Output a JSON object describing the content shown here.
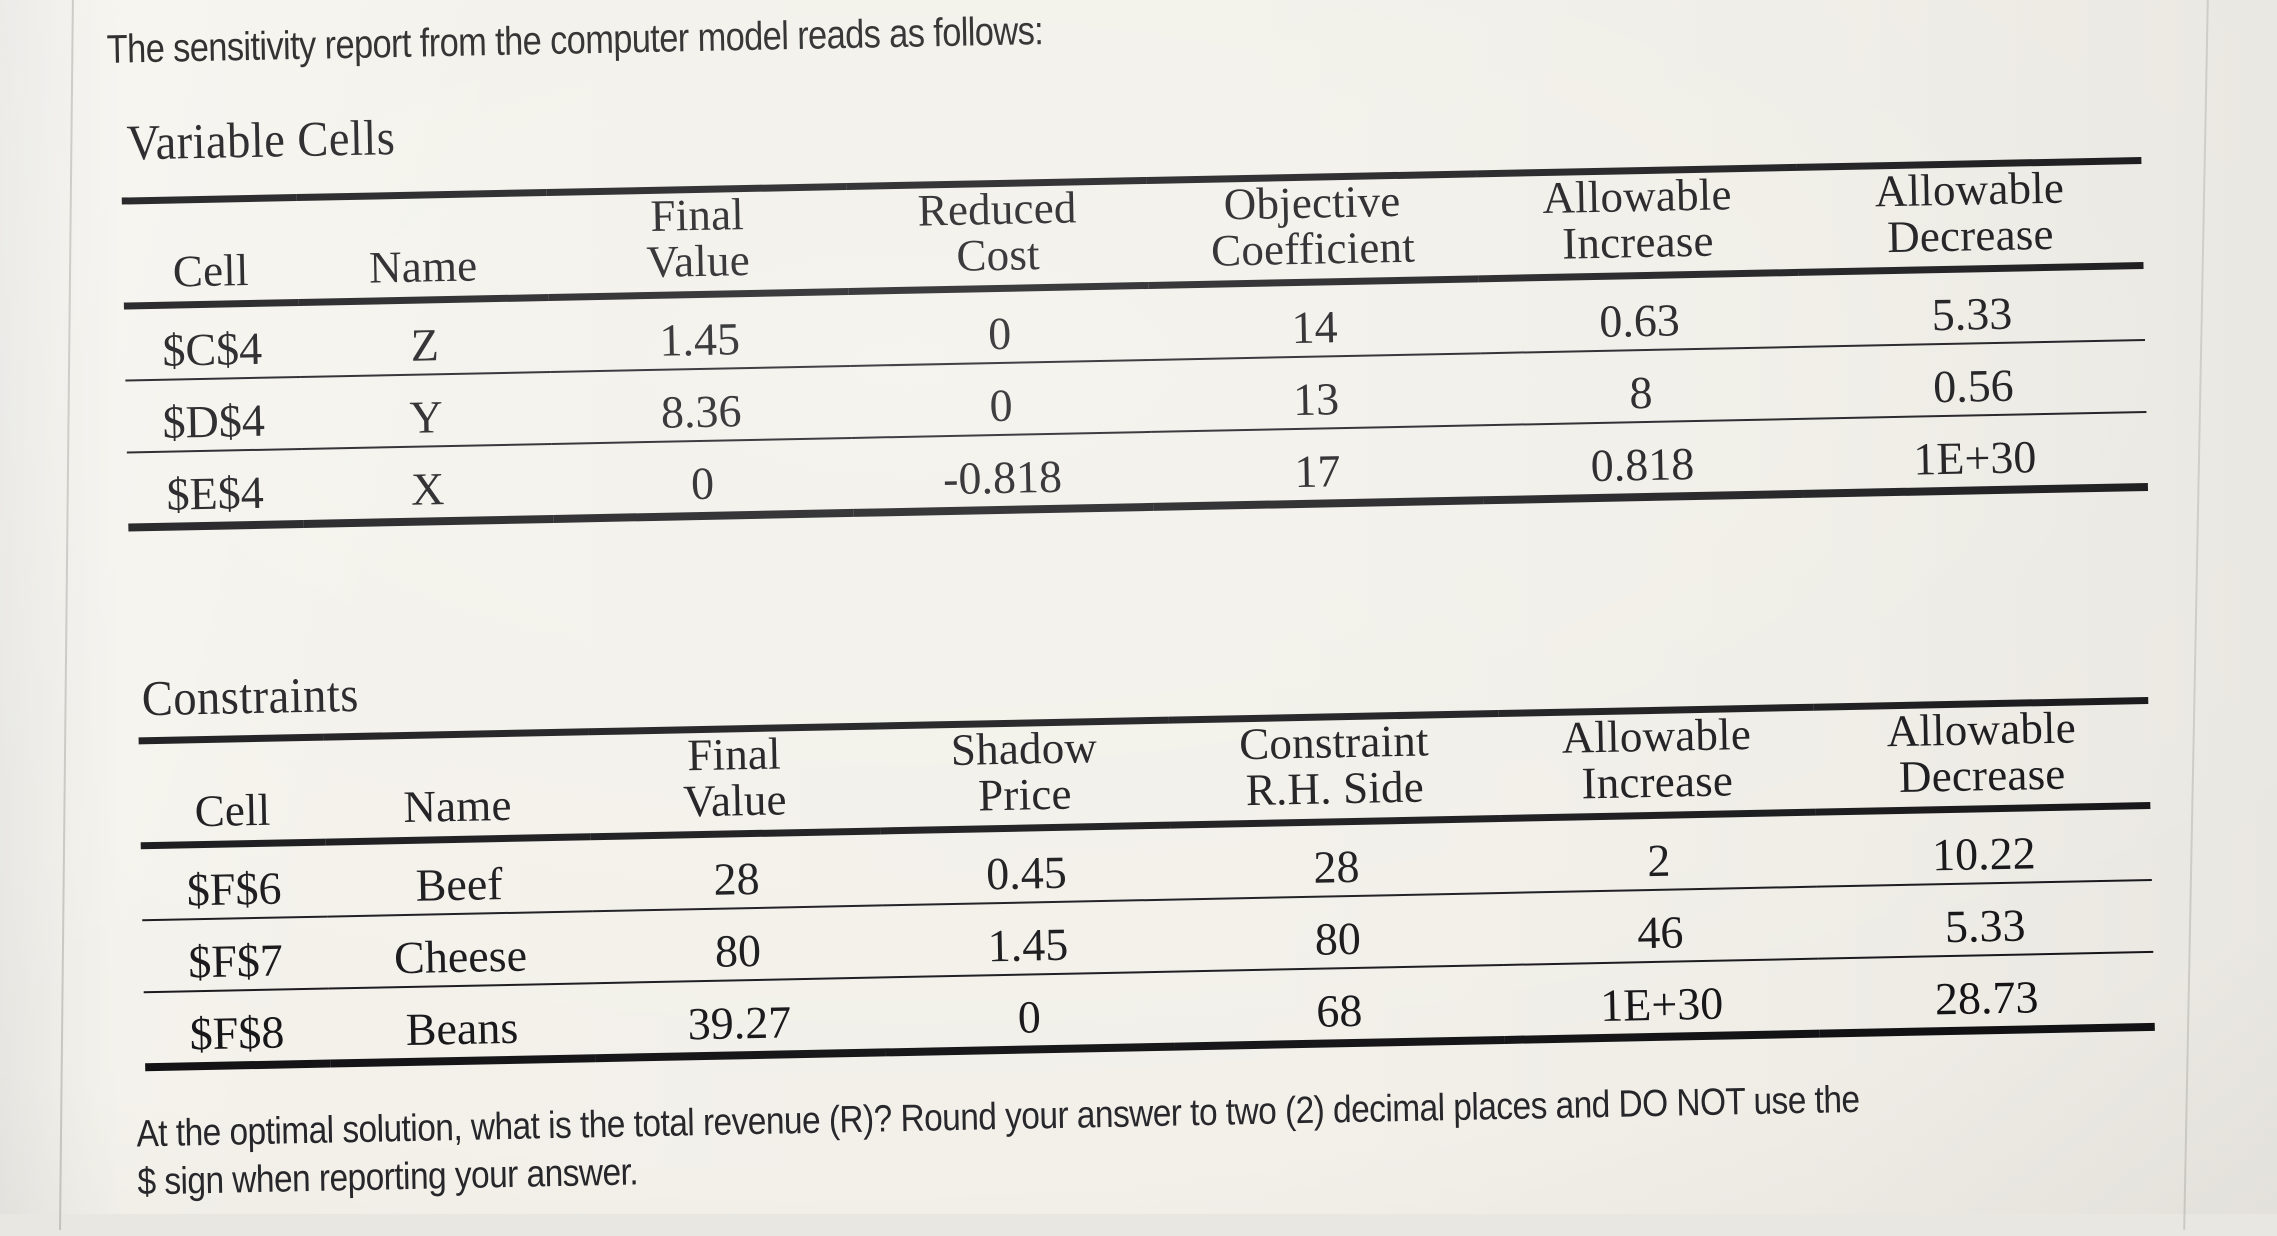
{
  "intro_text": "The sensitivity report from the computer model reads as follows:",
  "sections": {
    "variable_cells": {
      "title": "Variable Cells",
      "headers": [
        {
          "top": "",
          "bottom": "Cell"
        },
        {
          "top": "",
          "bottom": "Name"
        },
        {
          "top": "Final",
          "bottom": "Value"
        },
        {
          "top": "Reduced",
          "bottom": "Cost"
        },
        {
          "top": "Objective",
          "bottom": "Coefficient"
        },
        {
          "top": "Allowable",
          "bottom": "Increase"
        },
        {
          "top": "Allowable",
          "bottom": "Decrease"
        }
      ],
      "rows": [
        {
          "cell": "$C$4",
          "name": "Z",
          "final_value": "1.45",
          "reduced_cost": "0",
          "objective_coefficient": "14",
          "allowable_increase": "0.63",
          "allowable_decrease": "5.33"
        },
        {
          "cell": "$D$4",
          "name": "Y",
          "final_value": "8.36",
          "reduced_cost": "0",
          "objective_coefficient": "13",
          "allowable_increase": "8",
          "allowable_decrease": "0.56"
        },
        {
          "cell": "$E$4",
          "name": "X",
          "final_value": "0",
          "reduced_cost": "-0.818",
          "objective_coefficient": "17",
          "allowable_increase": "0.818",
          "allowable_decrease": "1E+30"
        }
      ]
    },
    "constraints": {
      "title": "Constraints",
      "headers": [
        {
          "top": "",
          "bottom": "Cell"
        },
        {
          "top": "",
          "bottom": "Name"
        },
        {
          "top": "Final",
          "bottom": "Value"
        },
        {
          "top": "Shadow",
          "bottom": "Price"
        },
        {
          "top": "Constraint",
          "bottom": "R.H. Side"
        },
        {
          "top": "Allowable",
          "bottom": "Increase"
        },
        {
          "top": "Allowable",
          "bottom": "Decrease"
        }
      ],
      "rows": [
        {
          "cell": "$F$6",
          "name": "Beef",
          "final_value": "28",
          "shadow_price": "0.45",
          "rhs": "28",
          "allowable_increase": "2",
          "allowable_decrease": "10.22"
        },
        {
          "cell": "$F$7",
          "name": "Cheese",
          "final_value": "80",
          "shadow_price": "1.45",
          "rhs": "80",
          "allowable_increase": "46",
          "allowable_decrease": "5.33"
        },
        {
          "cell": "$F$8",
          "name": "Beans",
          "final_value": "39.27",
          "shadow_price": "0",
          "rhs": "68",
          "allowable_increase": "1E+30",
          "allowable_decrease": "28.73"
        }
      ]
    }
  },
  "question": {
    "line1": "At the optimal solution, what is the total revenue (R)? Round your answer to two (2) decimal places and DO NOT use the",
    "line2": "$ sign when reporting your answer."
  },
  "colors": {
    "page_background": "#f2f0e9",
    "text": "#17171a",
    "rule": "#111114"
  }
}
